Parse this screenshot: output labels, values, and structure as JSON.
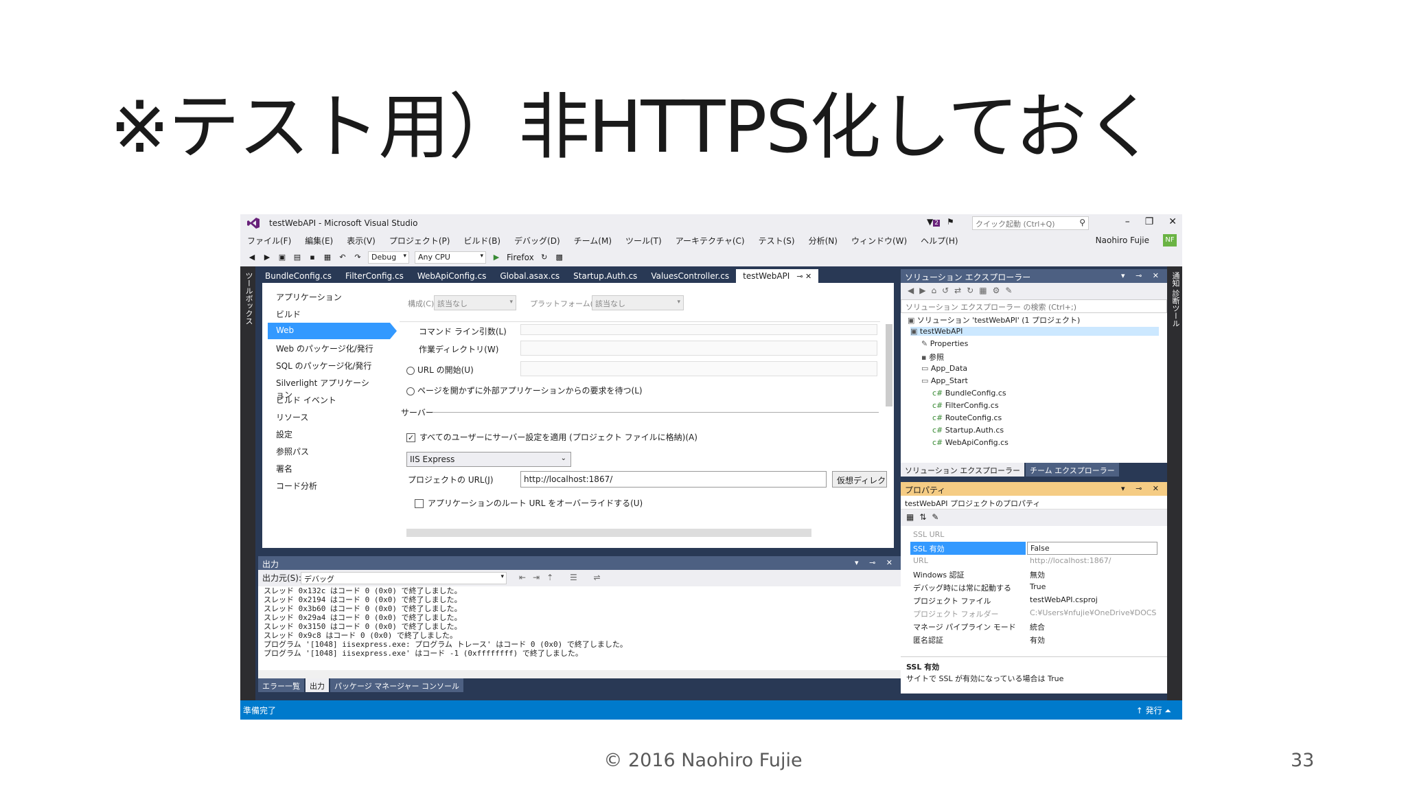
{
  "slide": {
    "title": "※テスト用）非HTTPS化しておく",
    "footer": "© 2016 Naohiro Fujie",
    "page_number": "33"
  },
  "window": {
    "title": "testWebAPI - Microsoft Visual Studio",
    "quick_launch_placeholder": "クイック起動 (Ctrl+Q)",
    "notification_count": "2",
    "user_name": "Naohiro Fujie",
    "user_initials": "NF"
  },
  "menu": [
    "ファイル(F)",
    "編集(E)",
    "表示(V)",
    "プロジェクト(P)",
    "ビルド(B)",
    "デバッグ(D)",
    "チーム(M)",
    "ツール(T)",
    "アーキテクチャ(C)",
    "テスト(S)",
    "分析(N)",
    "ウィンドウ(W)",
    "ヘルプ(H)"
  ],
  "toolbar": {
    "configuration": "Debug",
    "platform": "Any CPU",
    "browser": "Firefox"
  },
  "side_strips": {
    "left": "ツールボックス",
    "right": "通知 診断ツール"
  },
  "doc_tabs": [
    "BundleConfig.cs",
    "FilterConfig.cs",
    "WebApiConfig.cs",
    "Global.asax.cs",
    "Startup.Auth.cs",
    "ValuesController.cs",
    "testWebAPI"
  ],
  "project_props": {
    "nav": [
      "アプリケーション",
      "ビルド",
      "Web",
      "Web のパッケージ化/発行",
      "SQL のパッケージ化/発行",
      "Silverlight アプリケーション",
      "ビルド イベント",
      "リソース",
      "設定",
      "参照パス",
      "署名",
      "コード分析"
    ],
    "config_label": "構成(C):",
    "config_value": "該当なし",
    "platform_label": "プラットフォーム(M):",
    "platform_value": "該当なし",
    "cmdline_label": "コマンド ライン引数(L)",
    "workdir_label": "作業ディレクトリ(W)",
    "start_url_label": "URL の開始(U)",
    "wait_request_label": "ページを開かずに外部アプリケーションからの要求を待つ(L)",
    "servers_heading": "サーバー",
    "apply_all_users_label": "すべてのユーザーにサーバー設定を適用 (プロジェクト ファイルに格納)(A)",
    "server_value": "IIS Express",
    "project_url_label": "プロジェクトの URL(J)",
    "project_url_value": "http://localhost:1867/",
    "create_vdir_button": "仮想ディレクトリの作成(V)",
    "override_root_label": "アプリケーションのルート URL をオーバーライドする(U)"
  },
  "output": {
    "title": "出力",
    "source_label": "出力元(S):",
    "source_value": "デバッグ",
    "lines": [
      "スレッド 0x132c はコード 0 (0x0) で終了しました。",
      "スレッド 0x2194 はコード 0 (0x0) で終了しました。",
      "スレッド 0x3b60 はコード 0 (0x0) で終了しました。",
      "スレッド 0x29a4 はコード 0 (0x0) で終了しました。",
      "スレッド 0x3150 はコード 0 (0x0) で終了しました。",
      "スレッド 0x9c8 はコード 0 (0x0) で終了しました。",
      "プログラム '[1048] iisexpress.exe: プログラム トレース' はコード 0 (0x0) で終了しました。",
      "プログラム '[1048] iisexpress.exe' はコード -1 (0xffffffff) で終了しました。"
    ],
    "tabs": [
      "エラー一覧",
      "出力",
      "パッケージ マネージャー コンソール"
    ]
  },
  "solution_explorer": {
    "title": "ソリューション エクスプローラー",
    "search_placeholder": "ソリューション エクスプローラー の検索 (Ctrl+;)",
    "items": [
      "ソリューション 'testWebAPI' (1 プロジェクト)",
      "testWebAPI",
      "Properties",
      "参照",
      "App_Data",
      "App_Start",
      "BundleConfig.cs",
      "FilterConfig.cs",
      "RouteConfig.cs",
      "Startup.Auth.cs",
      "WebApiConfig.cs"
    ],
    "tabs": [
      "ソリューション エクスプローラー",
      "チーム エクスプローラー"
    ]
  },
  "properties": {
    "title": "プロパティ",
    "object": "testWebAPI  プロジェクトのプロパティ",
    "rows": [
      {
        "k": "SSL URL",
        "v": ""
      },
      {
        "k": "SSL 有効",
        "v": "False"
      },
      {
        "k": "URL",
        "v": "http://localhost:1867/"
      },
      {
        "k": "Windows 認証",
        "v": "無効"
      },
      {
        "k": "デバッグ時には常に起動する",
        "v": "True"
      },
      {
        "k": "プロジェクト ファイル",
        "v": "testWebAPI.csproj"
      },
      {
        "k": "プロジェクト フォルダー",
        "v": "C:¥Users¥nfujie¥OneDrive¥DOCS"
      },
      {
        "k": "マネージ パイプライン モード",
        "v": "統合"
      },
      {
        "k": "匿名認証",
        "v": "有効"
      }
    ],
    "desc_title": "SSL 有効",
    "desc_text": "サイトで SSL が有効になっている場合は True"
  },
  "status": {
    "left": "準備完了",
    "right": "発行"
  },
  "colors": {
    "accent": "#007acc",
    "pane_header": "#4d6082",
    "selection": "#3399ff",
    "body_bg": "#293955"
  }
}
